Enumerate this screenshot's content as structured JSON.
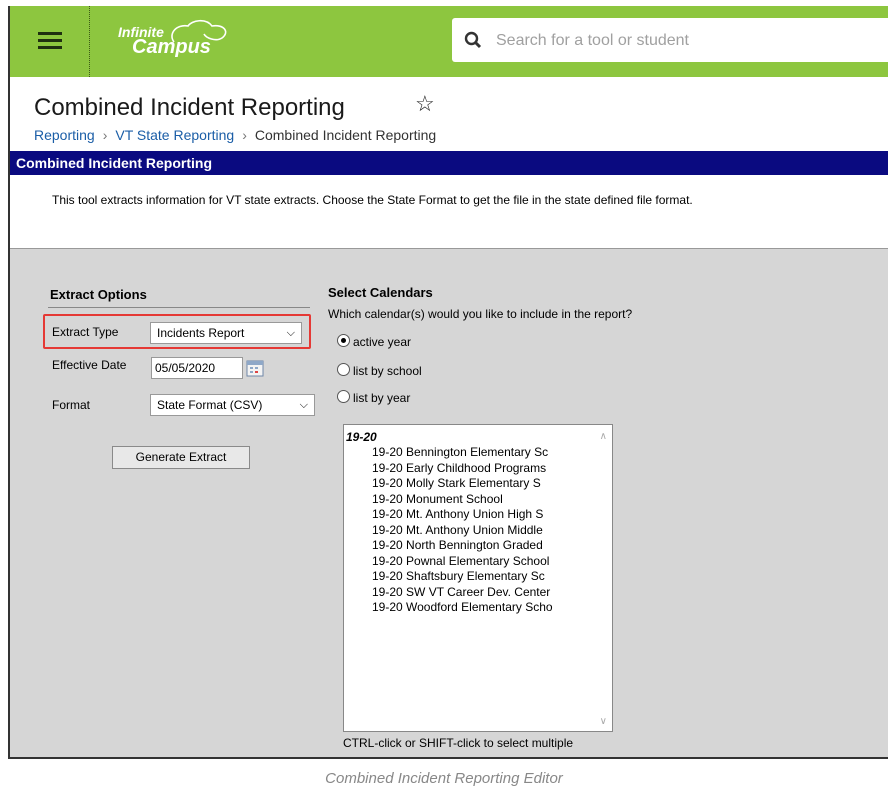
{
  "app": {
    "logo_line1": "Infinite",
    "logo_line2": "Campus"
  },
  "search": {
    "placeholder": "Search for a tool or student"
  },
  "page": {
    "title": "Combined Incident Reporting",
    "breadcrumb": [
      "Reporting",
      "VT State Reporting",
      "Combined Incident Reporting"
    ]
  },
  "section_bar": "Combined Incident Reporting",
  "description": "This tool extracts information for VT state extracts. Choose the State Format to get the file in the state defined file format.",
  "extract_options": {
    "heading": "Extract Options",
    "extract_type_label": "Extract Type",
    "extract_type_value": "Incidents Report",
    "effective_date_label": "Effective Date",
    "effective_date_value": "05/05/2020",
    "format_label": "Format",
    "format_value": "State Format (CSV)",
    "generate_button": "Generate Extract"
  },
  "calendars": {
    "heading": "Select Calendars",
    "question": "Which calendar(s) would you like to include in the report?",
    "options": [
      {
        "label": "active year",
        "selected": true
      },
      {
        "label": "list by school",
        "selected": false
      },
      {
        "label": "list by year",
        "selected": false
      }
    ],
    "group": "19-20",
    "items": [
      "19-20 Bennington Elementary Sc",
      "19-20 Early Childhood Programs",
      "19-20 Molly Stark Elementary S",
      "19-20 Monument School",
      "19-20 Mt. Anthony Union High S",
      "19-20 Mt. Anthony Union Middle",
      "19-20 North Bennington Graded",
      "19-20 Pownal Elementary School",
      "19-20 Shaftsbury Elementary Sc",
      "19-20 SW VT Career Dev. Center",
      "19-20 Woodford Elementary Scho"
    ],
    "hint": "CTRL-click or SHIFT-click to select multiple"
  },
  "caption": "Combined Incident Reporting Editor",
  "colors": {
    "topbar": "#8dc63f",
    "section_bar": "#0a0a80",
    "highlight": "#e53935",
    "link": "#1b5ea7"
  }
}
